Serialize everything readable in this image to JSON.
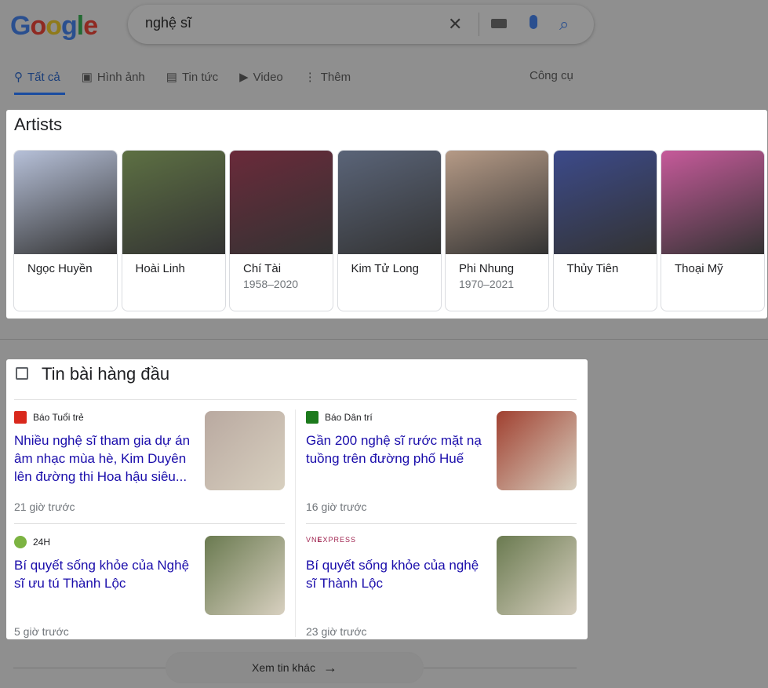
{
  "logo": "Google",
  "search": {
    "query": "nghệ sĩ"
  },
  "tabs": [
    {
      "label": "Tất cả",
      "icon": "search-icon"
    },
    {
      "label": "Hình ảnh",
      "icon": "image-icon"
    },
    {
      "label": "Tin tức",
      "icon": "news-icon"
    },
    {
      "label": "Video",
      "icon": "play-icon"
    },
    {
      "label": "Thêm",
      "icon": "more-vert-icon"
    }
  ],
  "tools_label": "Công cụ",
  "artists": {
    "title": "Artists",
    "items": [
      {
        "name": "Ngọc Huyền",
        "years": "",
        "color": "#b6c0d8"
      },
      {
        "name": "Hoài Linh",
        "years": "",
        "color": "#5d7043"
      },
      {
        "name": "Chí Tài",
        "years": "1958–2020",
        "color": "#6a2a3a"
      },
      {
        "name": "Kim Tử Long",
        "years": "",
        "color": "#5a6478"
      },
      {
        "name": "Phi Nhung",
        "years": "1970–2021",
        "color": "#b59a86"
      },
      {
        "name": "Thủy Tiên",
        "years": "",
        "color": "#3c4a8a"
      },
      {
        "name": "Thoại Mỹ",
        "years": "",
        "color": "#c65a9a"
      }
    ]
  },
  "news": {
    "title": "Tin bài hàng đầu",
    "items": [
      {
        "source": "Báo Tuổi trẻ",
        "source_color": "#d9281c",
        "title": "Nhiều nghệ sĩ tham gia dự án âm nhạc mùa hè, Kim Duyên lên đường thi Hoa hậu siêu...",
        "time": "21 giờ trước",
        "thumb": "#b9a9a0"
      },
      {
        "source": "Báo Dân trí",
        "source_color": "#1c7a1c",
        "title": "Gần 200 nghệ sĩ rước mặt nạ tuồng trên đường phố Huế",
        "time": "16 giờ trước",
        "thumb": "#a04030"
      },
      {
        "source": "24H",
        "source_color": "#7cb342",
        "title": "Bí quyết sống khỏe của Nghệ sĩ ưu tú Thành Lộc",
        "time": "5 giờ trước",
        "thumb": "#6a7a50"
      },
      {
        "source": "VNEXPRESS",
        "source_color": "#9f224e",
        "title": "Bí quyết sống khỏe của nghệ sĩ Thành Lộc",
        "time": "23 giờ trước",
        "thumb": "#6a7a50"
      }
    ]
  },
  "more_label": "Xem tin khác"
}
